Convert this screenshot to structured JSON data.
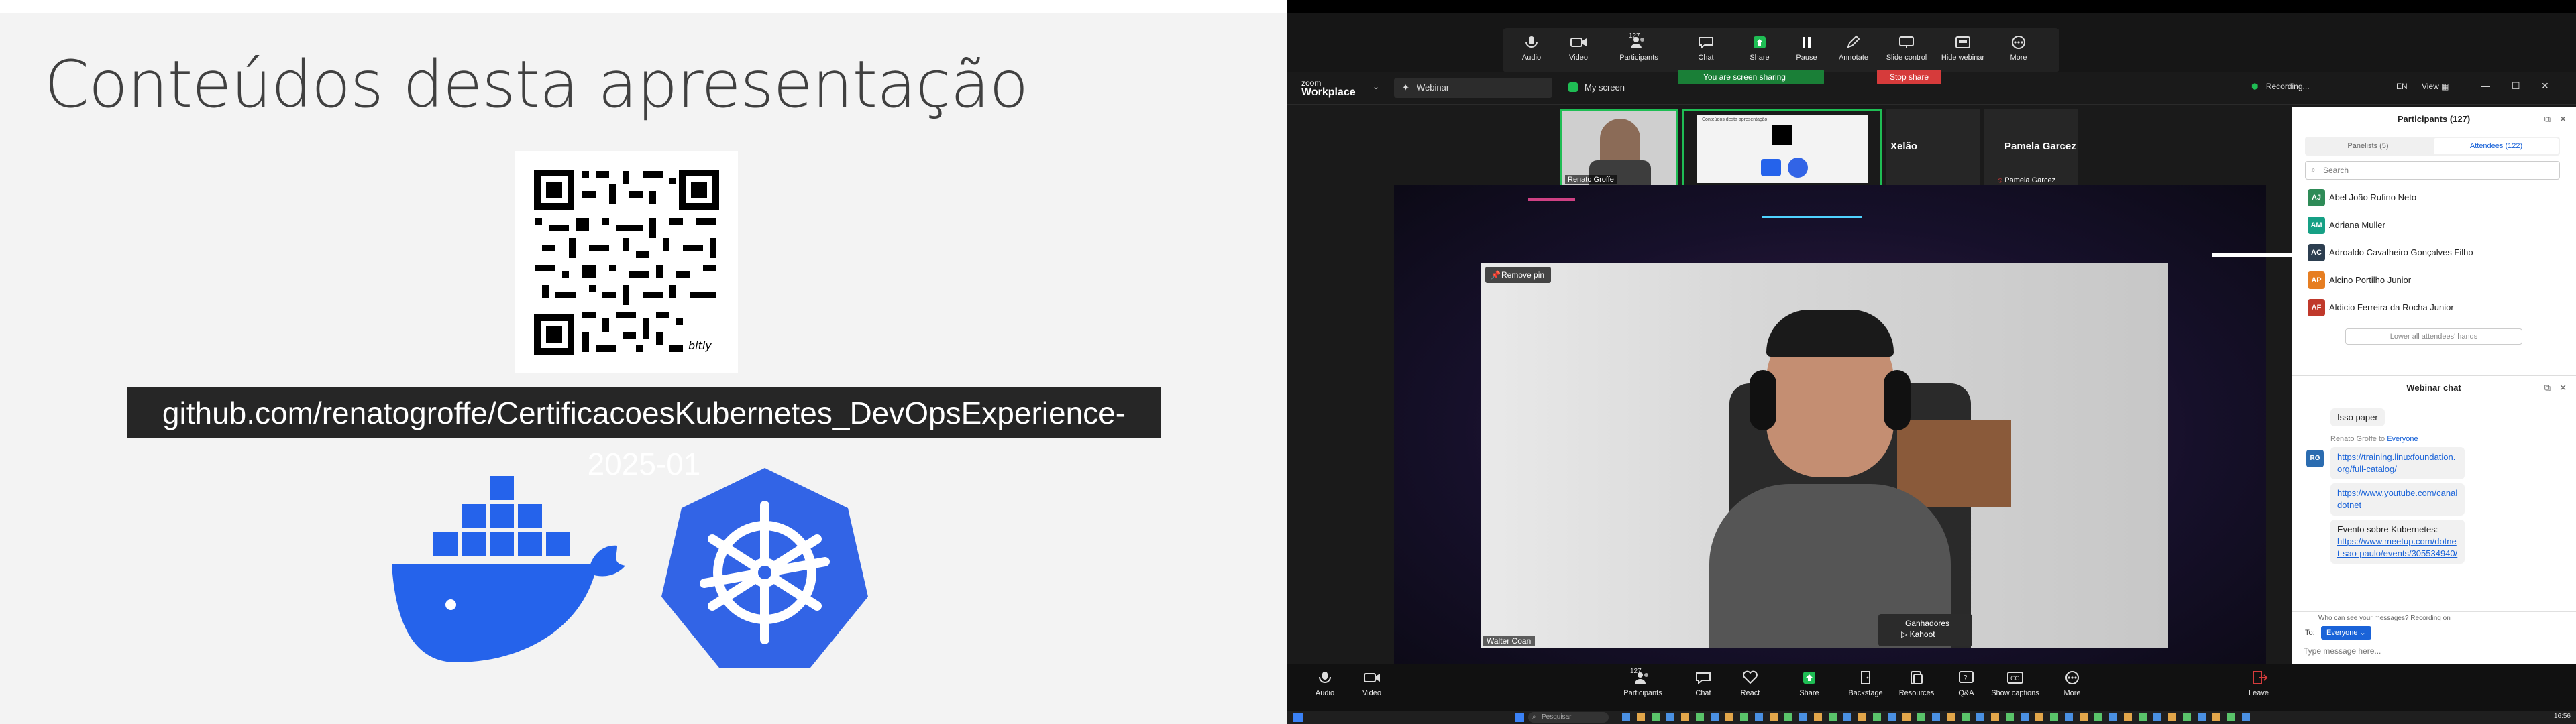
{
  "slide": {
    "title": "Conteúdos desta apresentação",
    "qr_badge": "bitly",
    "url": "github.com/renatogroffe/CertificacoesKubernetes_DevOpsExperience-2025-01"
  },
  "zoom": {
    "toolbar_top": {
      "audio": "Audio",
      "video": "Video",
      "participants": "Participants",
      "participants_count": "127",
      "chat": "Chat",
      "share": "Share",
      "pause": "Pause",
      "annotate": "Annotate",
      "slide_control": "Slide control",
      "hide_webinar": "Hide webinar",
      "more": "More"
    },
    "header": {
      "brand_small": "zoom",
      "brand": "Workplace",
      "webinar_pill": "Webinar",
      "my_screen_pill": "My screen",
      "sharing_banner": "You are screen sharing",
      "stop_share": "Stop share",
      "recording": "Recording...",
      "language": "EN",
      "view": "View"
    },
    "thumbs": [
      {
        "name": "Renato Groffe"
      },
      {
        "name": ""
      },
      {
        "name": "Xelão"
      },
      {
        "name": "Pamela Garcez",
        "subname": "Pamela Garcez"
      }
    ],
    "shared_preview_title": "Conteúdos desta apresentação",
    "video": {
      "remove_pin": "Remove pin",
      "name_tag": "Walter Coan"
    },
    "popup": {
      "line1": "Ganhadores",
      "line2": "Kahoot"
    },
    "toolbar_bottom": {
      "audio": "Audio",
      "video": "Video",
      "participants": "Participants",
      "participants_count": "127",
      "chat": "Chat",
      "react": "React",
      "share": "Share",
      "backstage": "Backstage",
      "resources": "Resources",
      "qa": "Q&A",
      "show_captions": "Show captions",
      "more": "More",
      "leave": "Leave"
    },
    "participants_panel": {
      "title": "Participants (127)",
      "tab_panelists": "Panelists (5)",
      "tab_attendees": "Attendees (122)",
      "search_placeholder": "Search",
      "people": [
        {
          "initials": "AJ",
          "name": "Abel João Rufino Neto",
          "color": "#2e8b57"
        },
        {
          "initials": "AM",
          "name": "Adriana Muller",
          "color": "#16a085"
        },
        {
          "initials": "AC",
          "name": "Adroaldo Cavalheiro Gonçalves Filho",
          "color": "#2c3e50"
        },
        {
          "initials": "AP",
          "name": "Alcino Portilho Junior",
          "color": "#e67e22"
        },
        {
          "initials": "AF",
          "name": "Aldicio Ferreira da Rocha Junior",
          "color": "#c0392b"
        }
      ],
      "lower_hands": "Lower all attendees' hands"
    },
    "chat_panel": {
      "title": "Webinar chat",
      "msg1": "Isso paper",
      "from": "Renato Groffe to",
      "to": "Everyone",
      "avatar": "RG",
      "link1": "https://training.linuxfoundation.org/full-catalog/",
      "link2": "https://www.youtube.com/canaldotnet",
      "event_label": "Evento sobre Kubernetes:",
      "link3": "https://www.meetup.com/dotnet-sao-paulo/events/305534940/",
      "who_can_see": "Who can see your messages? Recording on",
      "to_label": "To:",
      "to_value": "Everyone",
      "input_placeholder": "Type message here..."
    },
    "taskbar": {
      "search": "Pesquisar",
      "time": "16:56"
    }
  },
  "colors": {
    "docker_blue": "#2563eb",
    "k8s_blue": "#3264e6",
    "zoom_green": "#1a7f37",
    "stop_red": "#d63b3b"
  }
}
